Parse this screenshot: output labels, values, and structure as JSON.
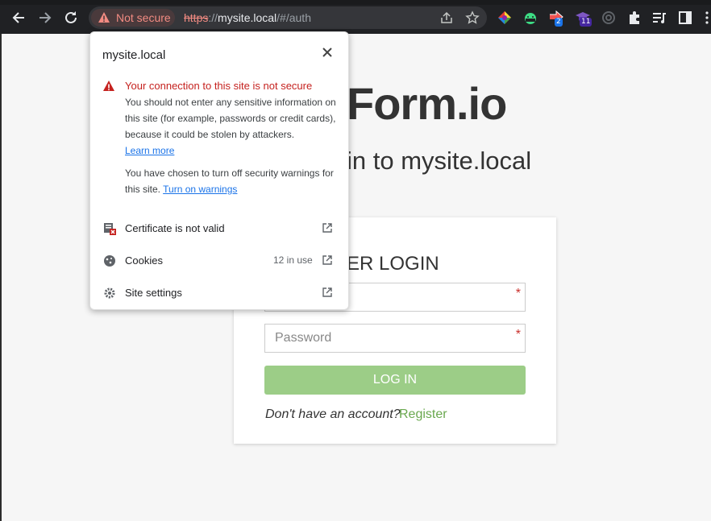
{
  "browser": {
    "security_chip_label": "Not secure",
    "url_scheme": "https",
    "url_host": "mysite.local",
    "url_path": "/#/auth",
    "extensions": [
      {
        "name": "colorful-extension-icon"
      },
      {
        "name": "android-extension-icon"
      },
      {
        "name": "red-arrow-extension-icon",
        "badge": "2"
      },
      {
        "name": "graduation-cap-extension-icon",
        "badge": "11"
      },
      {
        "name": "sync-extension-icon"
      }
    ]
  },
  "page": {
    "brand": "Form.io",
    "subtitle": "in to mysite.local",
    "login_title": "NING USER LOGIN",
    "username_placeholder": "",
    "password_placeholder": "Password",
    "required_mark": "*",
    "login_button": "LOG IN",
    "no_account_text": "Don't have an account?",
    "register_link": "Register",
    "colors": {
      "login_button": "#9ccd87",
      "register_link": "#6aa84f"
    }
  },
  "popup": {
    "site": "mysite.local",
    "warning_title": "Your connection to this site is not secure",
    "warning_body": "You should not enter any sensitive information on this site (for example, passwords or credit cards), because it could be stolen by attackers.",
    "learn_more": "Learn more",
    "warnings_off_text": "You have chosen to turn off security warnings for this site.",
    "turn_on_warnings": "Turn on warnings",
    "rows": [
      {
        "label": "Certificate is not valid",
        "meta": ""
      },
      {
        "label": "Cookies",
        "meta": "12 in use"
      },
      {
        "label": "Site settings",
        "meta": ""
      }
    ]
  }
}
